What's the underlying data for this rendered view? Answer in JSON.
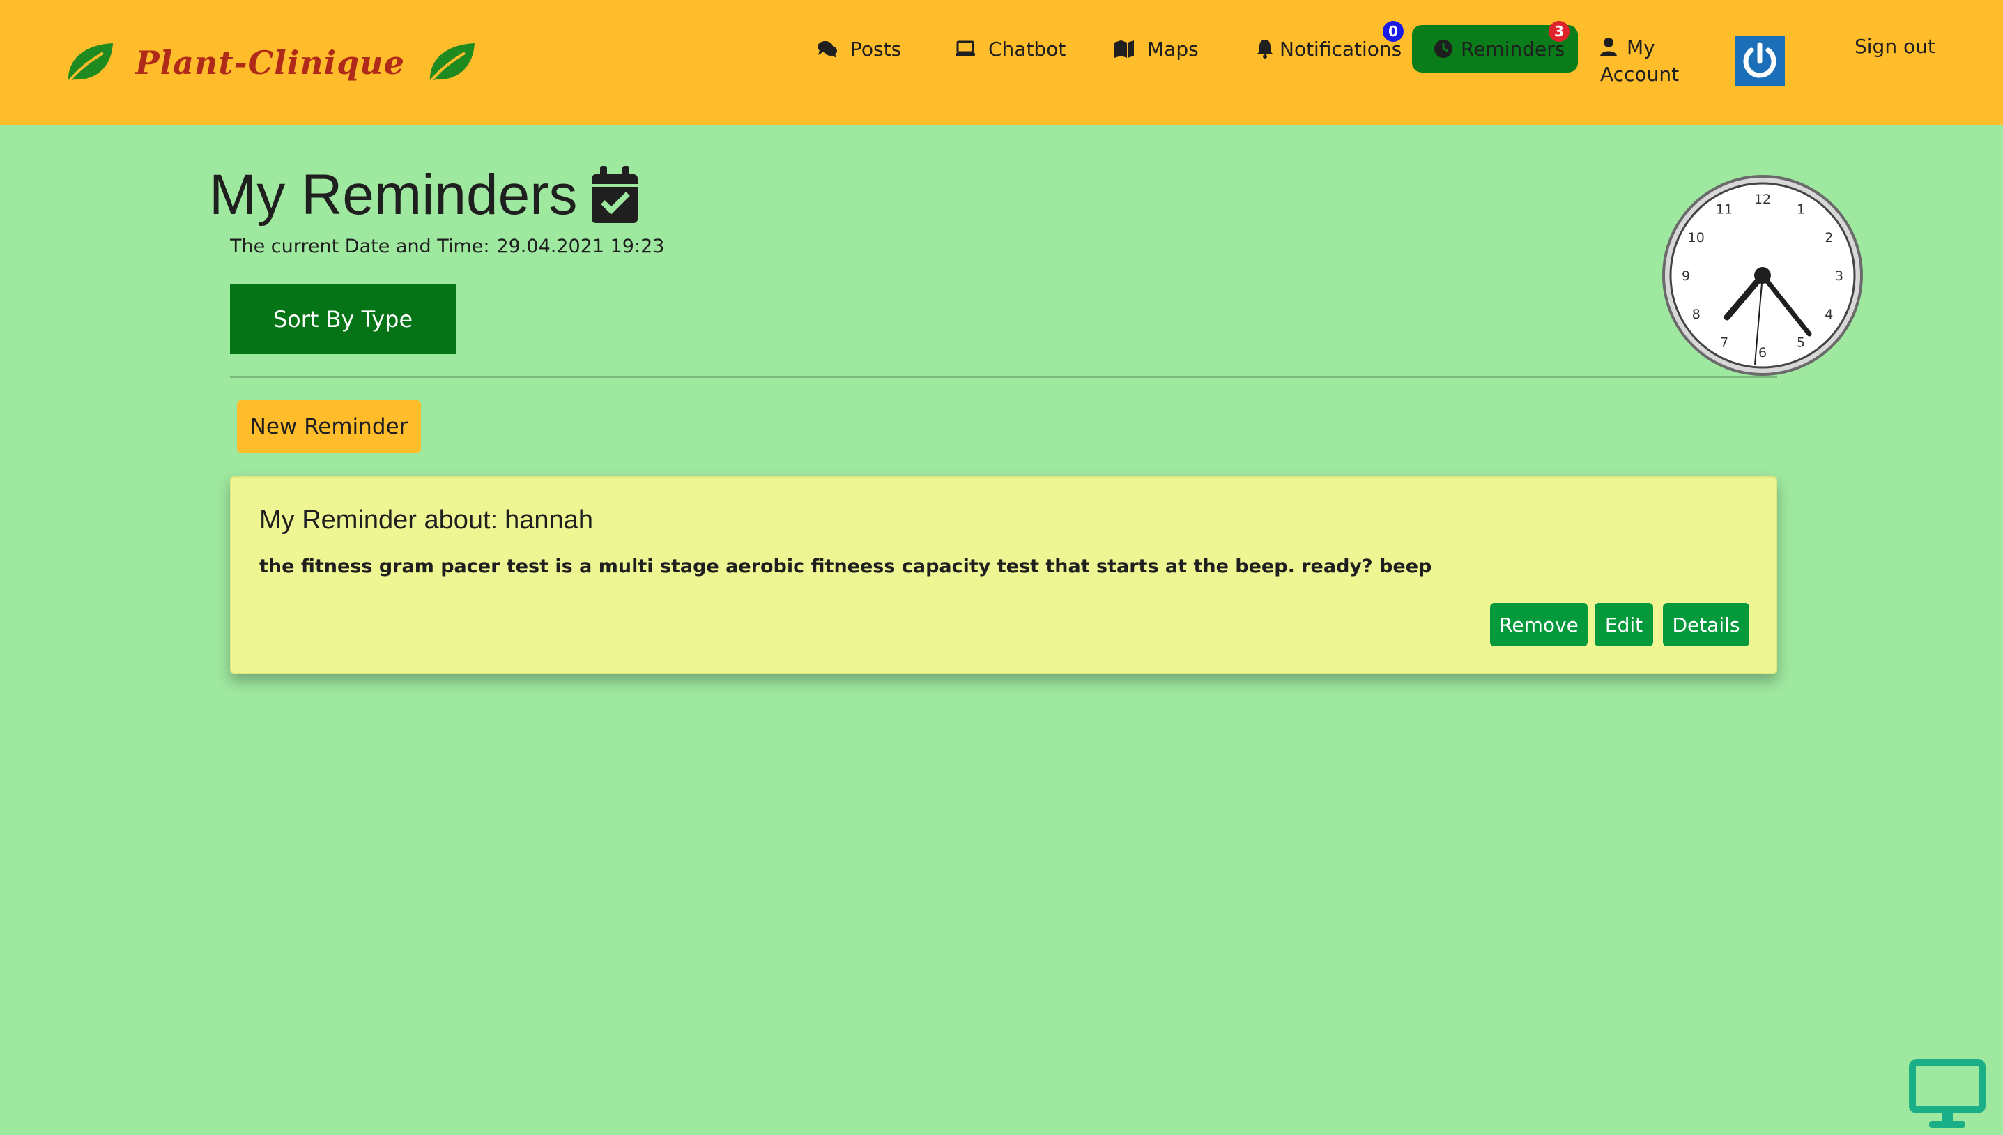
{
  "navbar": {
    "brand": "Plant-Clinique",
    "items": [
      {
        "label": "Posts",
        "icon": "comments-icon"
      },
      {
        "label": "Chatbot",
        "icon": "laptop-icon"
      },
      {
        "label": "Maps",
        "icon": "map-icon"
      },
      {
        "label": "Notifications",
        "icon": "bell-icon",
        "badge": "0",
        "badge_color": "#1a1ae6"
      },
      {
        "label": "Reminders",
        "icon": "clock-icon",
        "badge": "3",
        "badge_color": "#e0242b",
        "active": true
      }
    ],
    "account_label": "My Account",
    "account_line1": "My",
    "account_line2": "Account",
    "signout_label": "Sign out"
  },
  "page": {
    "title": "My Reminders",
    "datetime_label": "The current Date and Time:",
    "datetime_value": "29.04.2021 19:23",
    "sort_button": "Sort By Type",
    "new_button": "New Reminder"
  },
  "reminders": [
    {
      "title_prefix": "My Reminder about:",
      "subject": "hannah",
      "body": "the fitness gram pacer test is a multi stage aerobic fitneess capacity test that starts at the beep. ready? beep",
      "actions": {
        "remove": "Remove",
        "edit": "Edit",
        "details": "Details"
      }
    }
  ],
  "clock": {
    "numbers": [
      "12",
      "1",
      "2",
      "3",
      "4",
      "5",
      "6",
      "7",
      "8",
      "9",
      "10",
      "11"
    ],
    "time_shown": "19:23"
  },
  "colors": {
    "navbar": "#ffbc2b",
    "background": "#9ee8a0",
    "brand_text": "#b02a1a",
    "active_pill": "#0a7d1a",
    "card": "#eef593",
    "card_button": "#049a3c",
    "power_button": "#1a6fb8"
  }
}
